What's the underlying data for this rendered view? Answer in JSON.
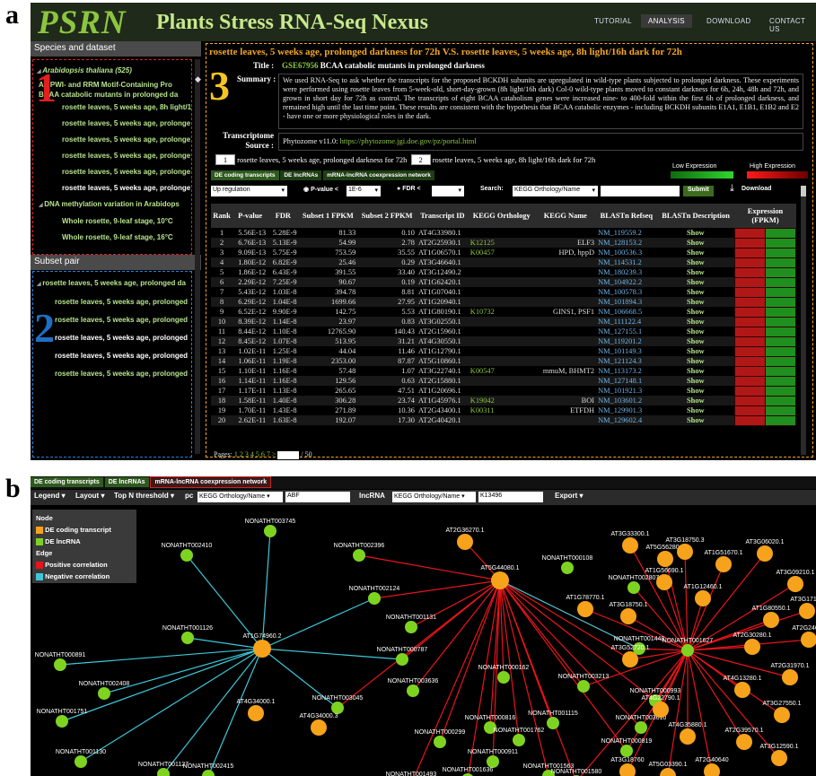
{
  "panel_labels": {
    "a": "a",
    "b": "b"
  },
  "numbers": {
    "n1": "1",
    "n2": "2",
    "n3": "3"
  },
  "header": {
    "logo": "PSRN",
    "title": "Plants Stress RNA-Seq Nexus",
    "nav": [
      "TUTORIAL",
      "ANALYSIS",
      "DOWNLOAD",
      "CONTACT US"
    ]
  },
  "left": {
    "species_head": "Species and dataset",
    "tree": [
      {
        "t": "Arabidopsis thaliana (525)",
        "c": "#b5e48c",
        "i": 4,
        "it": true
      },
      {
        "t": "An PWI- and RRM Motif-Containing Pro",
        "c": "#b5e48c",
        "i": 6
      },
      {
        "t": "BCAA catabolic mutants in prolonged da",
        "c": "#b5e48c",
        "i": 6
      },
      {
        "t": "rosette leaves, 5 weeks age, 8h light/1",
        "c": "#b5e48c",
        "i": 32
      },
      {
        "t": "rosette leaves, 5 weeks age, prolonge",
        "c": "#b5e48c",
        "i": 32
      },
      {
        "t": "rosette leaves, 5 weeks age, prolonge",
        "c": "#b5e48c",
        "i": 32
      },
      {
        "t": "rosette leaves, 5 weeks age, prolonge",
        "c": "#b5e48c",
        "i": 32
      },
      {
        "t": "rosette leaves, 5 weeks age, prolonge",
        "c": "#b5e48c",
        "i": 32
      },
      {
        "t": "rosette leaves, 5 weeks age, prolonge",
        "c": "#ffffff",
        "i": 32
      },
      {
        "t": "DNA methylation variation in Arabidops",
        "c": "#b5e48c",
        "i": 6
      },
      {
        "t": "Whole rosette, 9-leaf stage, 10°C",
        "c": "#b5e48c",
        "i": 32
      },
      {
        "t": "Whole rosette, 9-leaf stage, 16°C",
        "c": "#b5e48c",
        "i": 32
      }
    ],
    "subset_head": "Subset pair",
    "subsets": [
      {
        "t": "rosette leaves, 5 weeks age, prolonged da",
        "c": "#b5e48c"
      },
      {
        "t": "rosette leaves, 5 weeks age, prolonged",
        "c": "#b5e48c"
      },
      {
        "t": "rosette leaves, 5 weeks age, prolonged",
        "c": "#b5e48c"
      },
      {
        "t": "rosette leaves, 5 weeks age, prolonged",
        "c": "#ffffff"
      },
      {
        "t": "rosette leaves, 5 weeks age, prolonged",
        "c": "#ffffff"
      },
      {
        "t": "rosette leaves, 5 weeks age, prolonged",
        "c": "#b5e48c"
      }
    ]
  },
  "main": {
    "headline": "rosette leaves, 5 weeks age, prolonged darkness for 72h V.S. rosette leaves, 5 weeks age, 8h light/16h dark for 72h",
    "title_label": "Title :",
    "title_gse": "GSE67956",
    "title_text": " BCAA catabolic mutants in prolonged darkness",
    "summary_label": "Summary :",
    "summary": "We used RNA-Seq to ask whether the transcripts for the proposed BCKDH subunits are upregulated in wild-type plants subjected to prolonged darkness. These experiments were performed using rosette leaves from 5-week-old, short-day-grown (8h light/16h dark) Col-0 wild-type plants moved to constant darkness for 6h, 24h, 48h and 72h, and grown in short day for 72h as control. The transcripts of eight BCAA catabolism genes were increased nine- to 400-fold within the first 6h of prolonged darkness, and remained high until the last time point. These results are consistent with the hypothesis that BCAA catabolic enzymes - including BCKDH subunits E1A1, E1B1, E1B2 and E2 - have one or more physiological roles in the dark.",
    "source_label1": "Transcriptome",
    "source_label2": "Source :",
    "source_text": "Phytozome v11.0: ",
    "source_url": "https://phytozome.jgi.doe.gov/pz/portal.html",
    "subset1_num": "1",
    "subset1": "rosette leaves, 5 weeks age, prolonged darkness for 72h",
    "subset2_num": "2",
    "subset2": "rosette leaves, 5 weeks age, 8h light/16h dark for 72h",
    "tabs": [
      "DE coding transcripts",
      "DE lncRNAs",
      "mRNA-lncRNA coexpression network"
    ],
    "low_expr": "Low Expression",
    "high_expr": "High Expression",
    "filter": {
      "regulation": "Up regulation",
      "pval_label": "P-value <",
      "pval": "1E-6",
      "fdr_label": "FDR <",
      "fdr": "",
      "search_label": "Search:",
      "search_field": "KEGG Orthology/Name",
      "search_value": "",
      "submit": "Submit",
      "download": "Download"
    },
    "columns": [
      "Rank",
      "P-value",
      "FDR",
      "Subset 1 FPKM",
      "Subset 2 FPKM",
      "Transcript ID",
      "KEGG Orthology",
      "KEGG Name",
      "BLASTn Refseq",
      "BLASTn Description",
      "Expression (FPKM)"
    ],
    "expr_cols": [
      "1",
      "2"
    ],
    "rows": [
      [
        "1",
        "5.56E-13",
        "5.28E-9",
        "81.33",
        "0.10",
        "AT4G33980.1",
        "",
        "",
        "NM_119559.2",
        "Show"
      ],
      [
        "2",
        "6.76E-13",
        "5.13E-9",
        "54.99",
        "2.78",
        "AT2G25930.1",
        "K12125",
        "ELF3",
        "NM_128153.2",
        "Show"
      ],
      [
        "3",
        "9.09E-13",
        "5.75E-9",
        "753.59",
        "35.55",
        "AT1G06570.1",
        "K00457",
        "HPD, hppD",
        "NM_100536.3",
        "Show"
      ],
      [
        "4",
        "1.80E-12",
        "6.82E-9",
        "25.46",
        "0.29",
        "AT3G46640.1",
        "",
        "",
        "NM_114531.2",
        "Show"
      ],
      [
        "5",
        "1.86E-12",
        "6.43E-9",
        "391.55",
        "33.40",
        "AT3G12490.2",
        "",
        "",
        "NM_180239.3",
        "Show"
      ],
      [
        "6",
        "2.29E-12",
        "7.25E-9",
        "90.67",
        "0.19",
        "AT1G62420.1",
        "",
        "",
        "NM_104922.2",
        "Show"
      ],
      [
        "7",
        "5.43E-12",
        "1.03E-8",
        "394.78",
        "8.81",
        "AT1G07040.1",
        "",
        "",
        "NM_100578.3",
        "Show"
      ],
      [
        "8",
        "6.29E-12",
        "1.04E-8",
        "1699.66",
        "27.95",
        "AT1G20940.1",
        "",
        "",
        "NM_101894.3",
        "Show"
      ],
      [
        "9",
        "6.52E-12",
        "9.90E-9",
        "142.75",
        "5.53",
        "AT1G80190.1",
        "K10732",
        "GINS1, PSF1",
        "NM_106668.5",
        "Show"
      ],
      [
        "10",
        "8.39E-12",
        "1.14E-8",
        "23.97",
        "0.83",
        "AT3G02550.1",
        "",
        "",
        "NM_111122.4",
        "Show"
      ],
      [
        "11",
        "8.44E-12",
        "1.10E-8",
        "12765.90",
        "140.43",
        "AT2G15960.1",
        "",
        "",
        "NM_127155.1",
        "Show"
      ],
      [
        "12",
        "8.45E-12",
        "1.07E-8",
        "513.95",
        "31.21",
        "AT4G30550.1",
        "",
        "",
        "NM_119201.2",
        "Show"
      ],
      [
        "13",
        "1.02E-11",
        "1.25E-8",
        "44.04",
        "11.46",
        "AT1G12790.1",
        "",
        "",
        "NM_101149.3",
        "Show"
      ],
      [
        "14",
        "1.06E-11",
        "1.19E-8",
        "2353.00",
        "87.87",
        "AT5G10860.1",
        "",
        "",
        "NM_121124.3",
        "Show"
      ],
      [
        "15",
        "1.10E-11",
        "1.16E-8",
        "57.48",
        "1.07",
        "AT3G22740.1",
        "K00547",
        "mmuM, BHMT2",
        "NM_113173.2",
        "Show"
      ],
      [
        "16",
        "1.14E-11",
        "1.16E-8",
        "129.56",
        "0.63",
        "AT2G15880.1",
        "",
        "",
        "NM_127148.1",
        "Show"
      ],
      [
        "17",
        "1.17E-11",
        "1.13E-8",
        "265.65",
        "47.51",
        "AT1G20696.1",
        "",
        "",
        "NM_101921.3",
        "Show"
      ],
      [
        "18",
        "1.58E-11",
        "1.40E-8",
        "306.28",
        "23.74",
        "AT1G45976.1",
        "K19042",
        "BOI",
        "NM_103601.2",
        "Show"
      ],
      [
        "19",
        "1.70E-11",
        "1.43E-8",
        "271.89",
        "10.36",
        "AT2G43400.1",
        "K00311",
        "ETFDH",
        "NM_129901.3",
        "Show"
      ],
      [
        "20",
        "2.62E-11",
        "1.63E-8",
        "192.07",
        "17.30",
        "AT2G40420.1",
        "",
        "",
        "NM_129602.4",
        "Show"
      ]
    ],
    "pages_label": "Pages:",
    "pages": [
      "1",
      "2",
      "3",
      "4",
      "5",
      "6",
      "7",
      ">"
    ],
    "pages_total": "/ 50"
  },
  "network": {
    "tabs": [
      "DE coding transcripts",
      "DE lncRNAs",
      "mRNA-lncRNA coexpression network"
    ],
    "toolbar": {
      "legend": "Legend ▾",
      "layout": "Layout ▾",
      "topn": "Top N threshold ▾",
      "pc_label": "pc",
      "pc_field": "KEGG Orthology/Name ▾",
      "pc_value": "ABF",
      "lnc_label": "lncRNA",
      "lnc_field": "KEGG Orthology/Name ▾",
      "lnc_value": "K13496",
      "export": "Export ▾"
    },
    "legend": {
      "node_title": "Node",
      "coding": "DE coding transcript",
      "lnc": "DE lncRNA",
      "edge_title": "Edge",
      "pos": "Positive correlation",
      "neg": "Negative correlation"
    },
    "colors": {
      "coding": "#f7a21b",
      "lnc": "#7ed321",
      "pos": "#e8141b",
      "neg": "#3cc8d8"
    }
  }
}
